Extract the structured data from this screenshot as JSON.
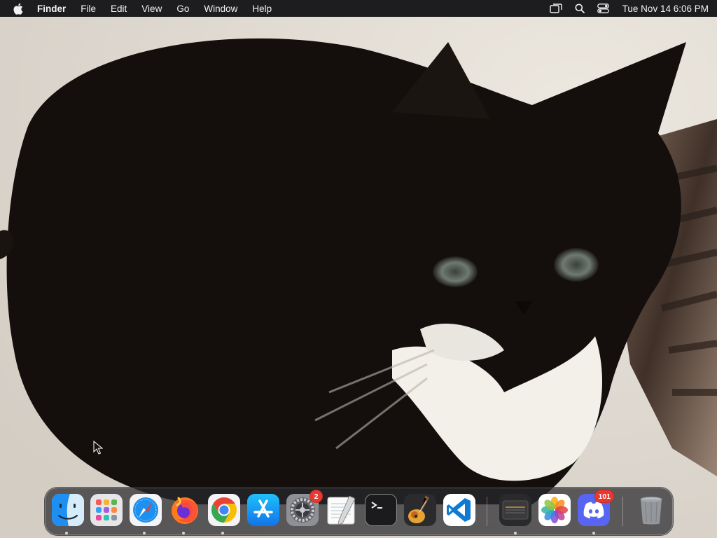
{
  "menubar": {
    "apple_icon": "apple-icon",
    "app_name": "Finder",
    "menus": [
      "File",
      "Edit",
      "View",
      "Go",
      "Window",
      "Help"
    ],
    "status_icons": [
      "screen-mirroring-icon",
      "spotlight-search-icon",
      "control-center-icon"
    ],
    "clock": "Tue Nov 14  6:06 PM"
  },
  "wallpaper": {
    "subject": "black-and-white cat photo",
    "colors": {
      "background": "#ddd7cf",
      "fur": "#140f0d",
      "white_fur": "#f3efe9",
      "eyes": "#5e6a63"
    }
  },
  "dock": {
    "apps": [
      {
        "name": "Finder",
        "icon": "finder-icon",
        "running": true
      },
      {
        "name": "Launchpad",
        "icon": "launchpad-icon",
        "running": false
      },
      {
        "name": "Safari",
        "icon": "safari-icon",
        "running": true
      },
      {
        "name": "Firefox",
        "icon": "firefox-icon",
        "running": true
      },
      {
        "name": "Google Chrome",
        "icon": "chrome-icon",
        "running": true
      },
      {
        "name": "App Store",
        "icon": "app-store-icon",
        "running": false
      },
      {
        "name": "System Settings",
        "icon": "system-settings-icon",
        "running": false,
        "badge": "2"
      },
      {
        "name": "TextEdit",
        "icon": "textedit-icon",
        "running": false
      },
      {
        "name": "Terminal",
        "icon": "terminal-icon",
        "running": false
      },
      {
        "name": "GarageBand",
        "icon": "garageband-icon",
        "running": false
      },
      {
        "name": "Visual Studio Code",
        "icon": "vscode-icon",
        "running": false
      },
      {
        "name": "Keyboard Utility",
        "icon": "keyboard-app-icon",
        "running": true
      },
      {
        "name": "Photos",
        "icon": "photos-icon",
        "running": false
      },
      {
        "name": "Discord",
        "icon": "discord-icon",
        "running": true,
        "badge": "101"
      },
      {
        "name": "Trash",
        "icon": "trash-icon",
        "running": false
      }
    ]
  }
}
